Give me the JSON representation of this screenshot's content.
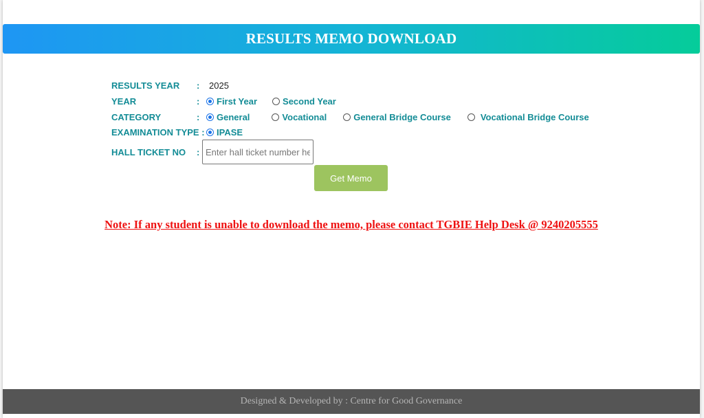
{
  "header": {
    "title": "RESULTS MEMO DOWNLOAD"
  },
  "form": {
    "colon": ":",
    "results_year": {
      "label": "RESULTS YEAR",
      "value": "2025"
    },
    "year": {
      "label": "YEAR",
      "options": [
        {
          "label": "First Year",
          "checked": true
        },
        {
          "label": "Second Year",
          "checked": false
        }
      ]
    },
    "category": {
      "label": "CATEGORY",
      "options": [
        {
          "label": "General",
          "checked": true
        },
        {
          "label": "Vocational",
          "checked": false
        },
        {
          "label": "General Bridge Course",
          "checked": false
        },
        {
          "label": "Vocational Bridge Course",
          "checked": false
        }
      ]
    },
    "exam_type": {
      "label": "EXAMINATION TYPE :",
      "options": [
        {
          "label": "IPASE",
          "checked": true
        }
      ]
    },
    "hall_ticket": {
      "label": "HALL TICKET NO",
      "value": "",
      "placeholder": "Enter hall ticket number here"
    },
    "submit_label": "Get Memo"
  },
  "note": "Note: If any student is unable to download the memo, please contact TGBIE Help Desk @ 9240205555",
  "footer": {
    "text": "Designed & Developed by : Centre for Good Governance"
  },
  "colors": {
    "label": "#138c96",
    "button": "#9dc45f",
    "note": "#ee1111",
    "footer_bg": "#555555"
  }
}
